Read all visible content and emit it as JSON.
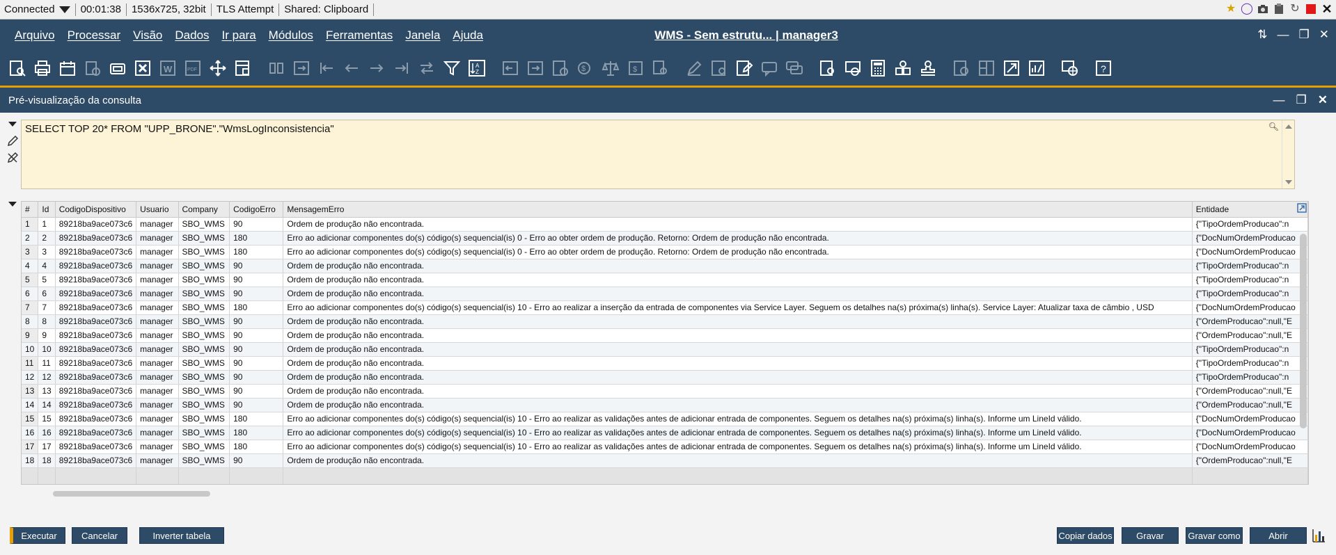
{
  "session": {
    "status": "Connected",
    "elapsed": "00:01:38",
    "resolution": "1536x725, 32bit",
    "tls": "TLS Attempt",
    "shared": "Shared: Clipboard"
  },
  "app": {
    "title": "WMS - Sem estrutu... | manager3",
    "menu": [
      "Arquivo",
      "Processar",
      "Visão",
      "Dados",
      "Ir para",
      "Módulos",
      "Ferramentas",
      "Janela",
      "Ajuda"
    ]
  },
  "panel": {
    "title": "Pré-visualização da consulta"
  },
  "query": {
    "text": "SELECT TOP 20* FROM \"UPP_BRONE\".\"WmsLogInconsistencia\""
  },
  "grid": {
    "columns": [
      "#",
      "Id",
      "CodigoDispositivo",
      "Usuario",
      "Company",
      "CodigoErro",
      "MensagemErro",
      "Entidade"
    ],
    "rows": [
      [
        "1",
        "1",
        "89218ba9ace073c6",
        "manager",
        "SBO_WMS",
        "90",
        "Ordem de produção não encontrada.",
        "{\"TipoOrdemProducao\":n"
      ],
      [
        "2",
        "2",
        "89218ba9ace073c6",
        "manager",
        "SBO_WMS",
        "180",
        "Erro ao adicionar componentes do(s) código(s) sequencial(is) 0 - Erro ao obter ordem de produção. Retorno: Ordem de produção não encontrada.",
        "{\"DocNumOrdemProducao"
      ],
      [
        "3",
        "3",
        "89218ba9ace073c6",
        "manager",
        "SBO_WMS",
        "180",
        "Erro ao adicionar componentes do(s) código(s) sequencial(is) 0 - Erro ao obter ordem de produção. Retorno: Ordem de produção não encontrada.",
        "{\"DocNumOrdemProducao"
      ],
      [
        "4",
        "4",
        "89218ba9ace073c6",
        "manager",
        "SBO_WMS",
        "90",
        "Ordem de produção não encontrada.",
        "{\"TipoOrdemProducao\":n"
      ],
      [
        "5",
        "5",
        "89218ba9ace073c6",
        "manager",
        "SBO_WMS",
        "90",
        "Ordem de produção não encontrada.",
        "{\"TipoOrdemProducao\":n"
      ],
      [
        "6",
        "6",
        "89218ba9ace073c6",
        "manager",
        "SBO_WMS",
        "90",
        "Ordem de produção não encontrada.",
        "{\"TipoOrdemProducao\":n"
      ],
      [
        "7",
        "7",
        "89218ba9ace073c6",
        "manager",
        "SBO_WMS",
        "180",
        "Erro ao adicionar componentes do(s) código(s) sequencial(is) 10 - Erro ao realizar a inserção da entrada de componentes via Service Layer. Seguem os detalhes na(s) próxima(s) linha(s). Service Layer: Atualizar taxa de câmbio  , USD",
        "{\"DocNumOrdemProducao"
      ],
      [
        "8",
        "8",
        "89218ba9ace073c6",
        "manager",
        "SBO_WMS",
        "90",
        "Ordem de produção não encontrada.",
        "{\"OrdemProducao\":null,\"E"
      ],
      [
        "9",
        "9",
        "89218ba9ace073c6",
        "manager",
        "SBO_WMS",
        "90",
        "Ordem de produção não encontrada.",
        "{\"OrdemProducao\":null,\"E"
      ],
      [
        "10",
        "10",
        "89218ba9ace073c6",
        "manager",
        "SBO_WMS",
        "90",
        "Ordem de produção não encontrada.",
        "{\"TipoOrdemProducao\":n"
      ],
      [
        "11",
        "11",
        "89218ba9ace073c6",
        "manager",
        "SBO_WMS",
        "90",
        "Ordem de produção não encontrada.",
        "{\"TipoOrdemProducao\":n"
      ],
      [
        "12",
        "12",
        "89218ba9ace073c6",
        "manager",
        "SBO_WMS",
        "90",
        "Ordem de produção não encontrada.",
        "{\"TipoOrdemProducao\":n"
      ],
      [
        "13",
        "13",
        "89218ba9ace073c6",
        "manager",
        "SBO_WMS",
        "90",
        "Ordem de produção não encontrada.",
        "{\"OrdemProducao\":null,\"E"
      ],
      [
        "14",
        "14",
        "89218ba9ace073c6",
        "manager",
        "SBO_WMS",
        "90",
        "Ordem de produção não encontrada.",
        "{\"OrdemProducao\":null,\"E"
      ],
      [
        "15",
        "15",
        "89218ba9ace073c6",
        "manager",
        "SBO_WMS",
        "180",
        "Erro ao adicionar componentes do(s) código(s) sequencial(is) 10 - Erro ao realizar as validações antes de adicionar entrada de componentes. Seguem os detalhes na(s) próxima(s) linha(s). Informe um LineId válido.",
        "{\"DocNumOrdemProducao"
      ],
      [
        "16",
        "16",
        "89218ba9ace073c6",
        "manager",
        "SBO_WMS",
        "180",
        "Erro ao adicionar componentes do(s) código(s) sequencial(is) 10 - Erro ao realizar as validações antes de adicionar entrada de componentes. Seguem os detalhes na(s) próxima(s) linha(s). Informe um LineId válido.",
        "{\"DocNumOrdemProducao"
      ],
      [
        "17",
        "17",
        "89218ba9ace073c6",
        "manager",
        "SBO_WMS",
        "180",
        "Erro ao adicionar componentes do(s) código(s) sequencial(is) 10 - Erro ao realizar as validações antes de adicionar entrada de componentes. Seguem os detalhes na(s) próxima(s) linha(s). Informe um LineId válido.",
        "{\"DocNumOrdemProducao"
      ],
      [
        "18",
        "18",
        "89218ba9ace073c6",
        "manager",
        "SBO_WMS",
        "90",
        "Ordem de produção não encontrada.",
        "{\"OrdemProducao\":null,\"E"
      ]
    ]
  },
  "buttons": {
    "executar": "Executar",
    "cancelar": "Cancelar",
    "inverter": "Inverter tabela",
    "copiar": "Copiar dados",
    "gravar": "Gravar",
    "gravar_como": "Gravar como",
    "abrir": "Abrir"
  },
  "colors": {
    "header": "#2d4a66",
    "accent": "#e8a000",
    "query_bg": "#fdf3d6"
  }
}
